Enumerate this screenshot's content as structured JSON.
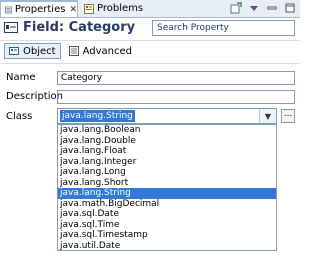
{
  "tabs": [
    {
      "label": "Properties",
      "icon": "properties-icon",
      "active": true
    },
    {
      "label": "Problems",
      "icon": "problems-icon",
      "active": false
    }
  ],
  "header": {
    "title": "Field: Category",
    "title_icon": "field-icon",
    "search_placeholder": "Search Property"
  },
  "subtabs": [
    {
      "label": "Object",
      "icon": "object-icon",
      "selected": true
    },
    {
      "label": "Advanced",
      "icon": "advanced-icon",
      "selected": false
    }
  ],
  "form": {
    "name_label": "Name",
    "name_value": "Category",
    "description_label": "Description",
    "description_value": "",
    "class_label": "Class",
    "class_value": "java.lang.String",
    "ellipsis_label": "..."
  },
  "class_options": [
    "java.lang.Boolean",
    "java.lang.Double",
    "java.lang.Float",
    "java.lang.Integer",
    "java.lang.Long",
    "java.lang.Short",
    "java.lang.String",
    "java.math.BigDecimal",
    "java.sql.Date",
    "java.sql.Time",
    "java.sql.Timestamp",
    "java.util.Date"
  ],
  "selected_option_index": 6,
  "colors": {
    "accent": "#3378d6",
    "title": "#283a67"
  }
}
